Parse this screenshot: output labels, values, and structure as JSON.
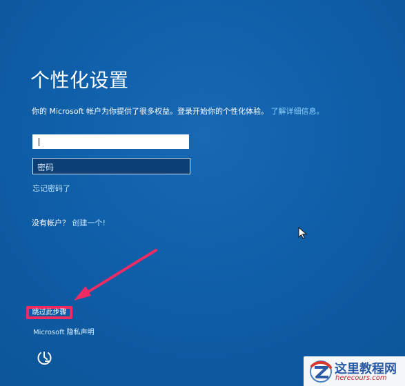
{
  "page": {
    "title": "个性化设置",
    "intro_text": "你的 Microsoft 帐户为你提供了很多权益。登录开始你的个性化体验。",
    "learn_more_link": "了解详细信息。",
    "password_placeholder": "密码",
    "forgot_password": "忘记密码了",
    "no_account_text": "没有帐户？",
    "create_one_link": "创建一个!",
    "skip_step": "跳过此步骤",
    "privacy_statement": "Microsoft 隐私声明"
  },
  "watermark": {
    "title": "这里教程网",
    "url": "herecours.com"
  },
  "icons": {
    "accessibility": "accessibility-icon",
    "cursor": "mouse-cursor-icon",
    "annotation_arrow": "annotation-arrow-icon",
    "watermark_logo": "watermark-logo-icon"
  },
  "colors": {
    "background": "#0f5ea8",
    "link": "#8fd3ff",
    "highlight": "#ee2b62",
    "watermark_blue": "#2b5ba4",
    "watermark_red": "#c52226"
  }
}
